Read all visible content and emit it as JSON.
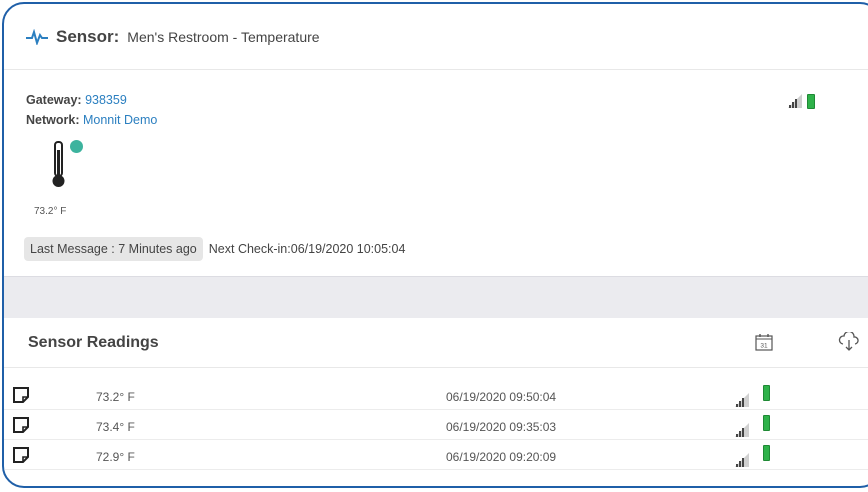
{
  "sensor": {
    "label": "Sensor:",
    "name": "Men's Restroom - Temperature",
    "gateway_key": "Gateway:",
    "gateway_value": "938359",
    "network_key": "Network:",
    "network_value": "Monnit Demo",
    "current_temp": "73.2° F",
    "last_message": "Last Message : 7 Minutes ago",
    "next_checkin": "Next Check-in:06/19/2020 10:05:04",
    "status_color": "#3db39e",
    "battery_color": "#2fb24a"
  },
  "readings": {
    "title": "Sensor Readings",
    "calendar_day": "31",
    "rows": [
      {
        "value": "73.2° F",
        "date": "06/19/2020 09:50:04"
      },
      {
        "value": "73.4° F",
        "date": "06/19/2020 09:35:03"
      },
      {
        "value": "72.9° F",
        "date": "06/19/2020 09:20:09"
      }
    ]
  },
  "icons": {
    "header": "pulse-icon",
    "thermometer": "thermometer-icon",
    "signal": "signal-strength-icon",
    "battery": "battery-icon",
    "calendar": "calendar-icon",
    "export": "cloud-download-icon",
    "note": "note-icon"
  },
  "colors": {
    "frame_border": "#1f5fa8",
    "link": "#2b7fc0",
    "band": "#ebebef"
  }
}
